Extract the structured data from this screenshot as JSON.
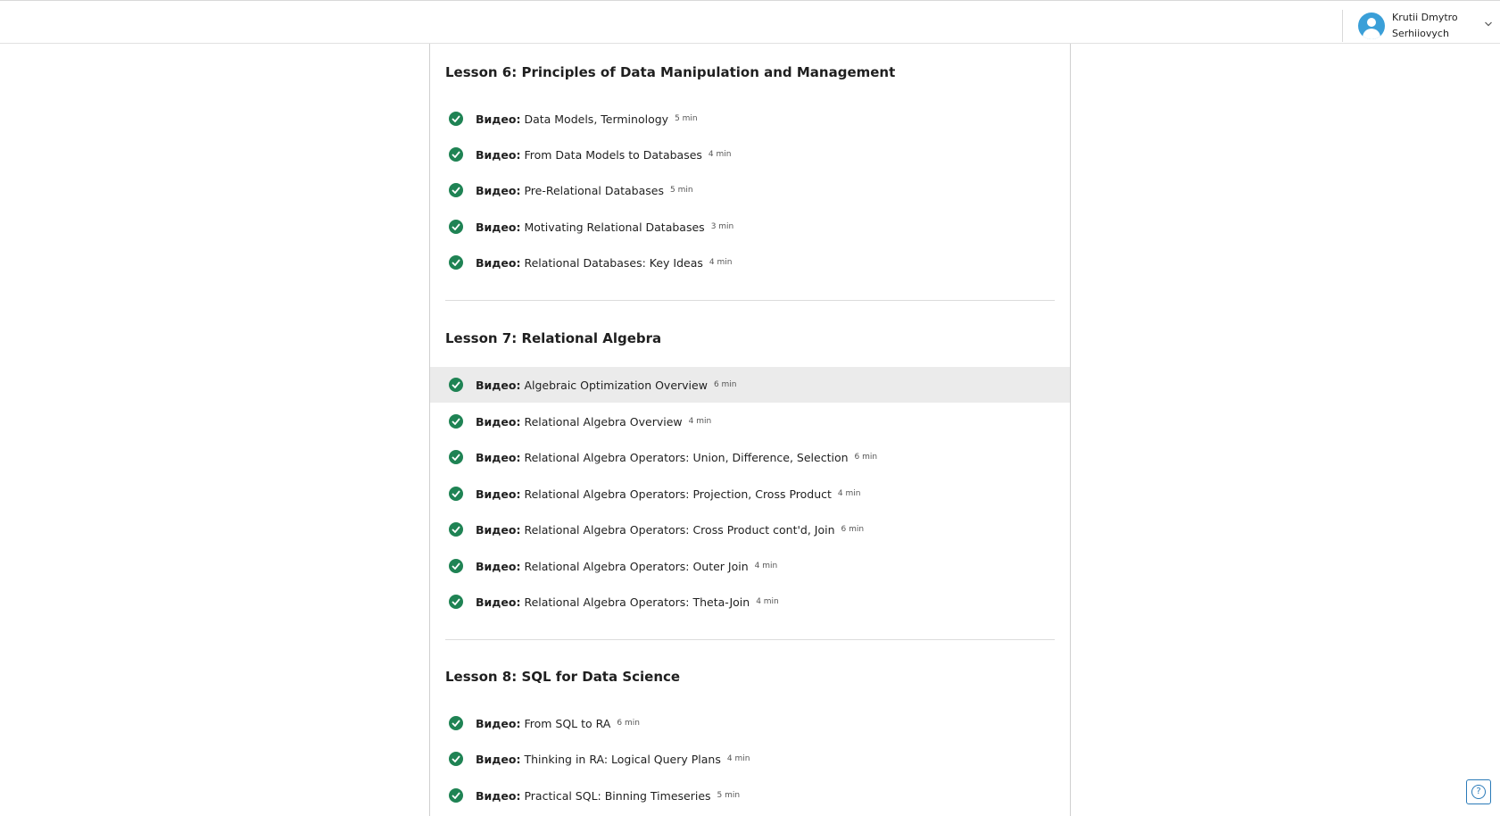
{
  "header": {
    "user_name": "Krutii Dmytro Serhiiovych",
    "avatar_color": "#3a9fd8"
  },
  "colors": {
    "completed_check": "#1f8354",
    "selected_row_bg": "#ebebeb",
    "help_accent": "#2a7ab8"
  },
  "lessons": [
    {
      "title": "Lesson 6: Principles of Data Manipulation and Management",
      "items": [
        {
          "type": "Видео:",
          "title": "Data Models, Terminology",
          "duration": "5 min",
          "completed": true
        },
        {
          "type": "Видео:",
          "title": "From Data Models to Databases",
          "duration": "4 min",
          "completed": true
        },
        {
          "type": "Видео:",
          "title": "Pre-Relational Databases",
          "duration": "5 min",
          "completed": true
        },
        {
          "type": "Видео:",
          "title": "Motivating Relational Databases",
          "duration": "3 min",
          "completed": true
        },
        {
          "type": "Видео:",
          "title": "Relational Databases: Key Ideas",
          "duration": "4 min",
          "completed": true
        }
      ]
    },
    {
      "title": "Lesson 7: Relational Algebra",
      "items": [
        {
          "type": "Видео:",
          "title": "Algebraic Optimization Overview",
          "duration": "6 min",
          "completed": true,
          "selected": true
        },
        {
          "type": "Видео:",
          "title": "Relational Algebra Overview",
          "duration": "4 min",
          "completed": true
        },
        {
          "type": "Видео:",
          "title": "Relational Algebra Operators: Union, Difference, Selection",
          "duration": "6 min",
          "completed": true
        },
        {
          "type": "Видео:",
          "title": "Relational Algebra Operators: Projection, Cross Product",
          "duration": "4 min",
          "completed": true
        },
        {
          "type": "Видео:",
          "title": "Relational Algebra Operators: Cross Product cont'd, Join",
          "duration": "6 min",
          "completed": true
        },
        {
          "type": "Видео:",
          "title": "Relational Algebra Operators: Outer Join",
          "duration": "4 min",
          "completed": true
        },
        {
          "type": "Видео:",
          "title": "Relational Algebra Operators: Theta-Join",
          "duration": "4 min",
          "completed": true
        }
      ]
    },
    {
      "title": "Lesson 8: SQL for Data Science",
      "items": [
        {
          "type": "Видео:",
          "title": "From SQL to RA",
          "duration": "6 min",
          "completed": true
        },
        {
          "type": "Видео:",
          "title": "Thinking in RA: Logical Query Plans",
          "duration": "4 min",
          "completed": true
        },
        {
          "type": "Видео:",
          "title": "Practical SQL: Binning Timeseries",
          "duration": "5 min",
          "completed": true
        }
      ]
    }
  ],
  "help": {
    "icon": "?"
  }
}
